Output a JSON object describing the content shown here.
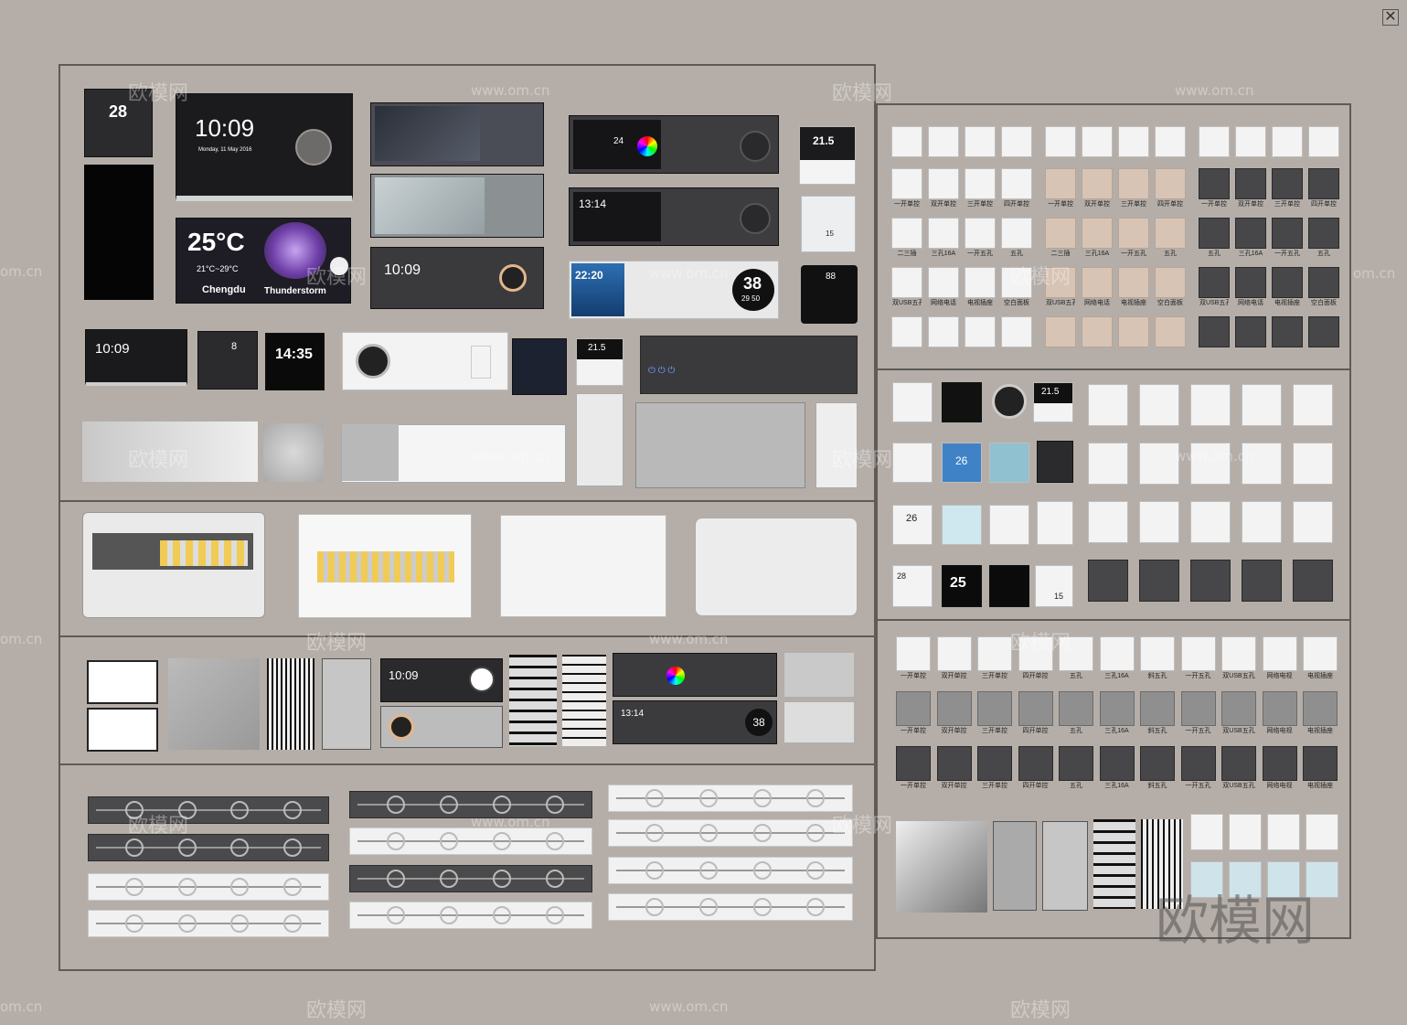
{
  "watermarks": {
    "logo": "欧模网",
    "site": "www.om.cn",
    "site_short": "om.cn"
  },
  "window": {
    "close_glyph": "✕"
  },
  "left_board": {
    "thermostat_small": {
      "temp": "28"
    },
    "tablet_clock": {
      "time": "10:09",
      "date": "Monday, 11 May 2016"
    },
    "weather_panel": {
      "temp": "25°C",
      "range": "21°C~29°C",
      "city": "Chengdu",
      "condition": "Thunderstorm"
    },
    "panel_mini_clock": {
      "time": "10:09"
    },
    "mini_switch": {
      "temp": "8"
    },
    "clock_panel": {
      "time": "14:35"
    },
    "thermo_right_top": {
      "temp": "21.5"
    },
    "thermo_right_mid": {
      "temp": "15"
    },
    "thermo_dark": {
      "temp": "88"
    },
    "smart_panel_a": {
      "temp": "24"
    },
    "smart_panel_b": {
      "time": "13:14"
    },
    "smart_panel_c": {
      "time": "22:20",
      "dial": "38",
      "dial_sub": "29 50"
    },
    "dial_panel_temp": {
      "temp": "21.5"
    },
    "row3_clock": {
      "time": "10:09"
    },
    "row3_panel": {
      "time": "13:14",
      "dial": "38"
    },
    "row1_clock_panel": {
      "time": "10:09"
    }
  },
  "right_top": {
    "thermo_a": {
      "temp": "21.5"
    },
    "thermo_b": {
      "temp": "26"
    },
    "thermo_c": {
      "temp": "25"
    },
    "thermo_d": {
      "temp": "28"
    },
    "thermo_e": {
      "temp": "15"
    },
    "thermo_f": {
      "temp": "26"
    }
  },
  "labels": {
    "r1": [
      "一开单控",
      "双开单控",
      "三开单控",
      "四开单控",
      "一开单控",
      "双开单控",
      "三开单控",
      "四开单控",
      "一开单控",
      "双开单控",
      "三开单控",
      "四开单控"
    ],
    "r2": [
      "二三插",
      "三孔16A",
      "一开五孔",
      "五孔",
      "二三插",
      "三孔16A",
      "一开五孔",
      "五孔",
      "五孔",
      "三孔16A",
      "一开五孔",
      "五孔"
    ],
    "r3": [
      "双USB五孔",
      "网络电话",
      "电视插座",
      "空白面板",
      "双USB五孔",
      "网络电话",
      "电视插座",
      "空白面板",
      "双USB五孔",
      "网络电话",
      "电视插座",
      "空白面板"
    ],
    "b1": [
      "一开单控",
      "双开单控",
      "三开单控",
      "四开单控",
      "五孔",
      "三孔16A",
      "斜五孔",
      "一开五孔",
      "双USB五孔",
      "网络电视",
      "电视插座"
    ],
    "b2": [
      "一开单控",
      "双开单控",
      "三开单控",
      "四开单控",
      "五孔",
      "三孔16A",
      "斜五孔",
      "一开五孔",
      "双USB五孔",
      "网络电视",
      "电视插座"
    ],
    "b3": [
      "一开单控",
      "双开单控",
      "三开单控",
      "四开单控",
      "五孔",
      "三孔16A",
      "斜五孔",
      "一开五孔",
      "双USB五孔",
      "网络电视",
      "电视插座"
    ]
  }
}
